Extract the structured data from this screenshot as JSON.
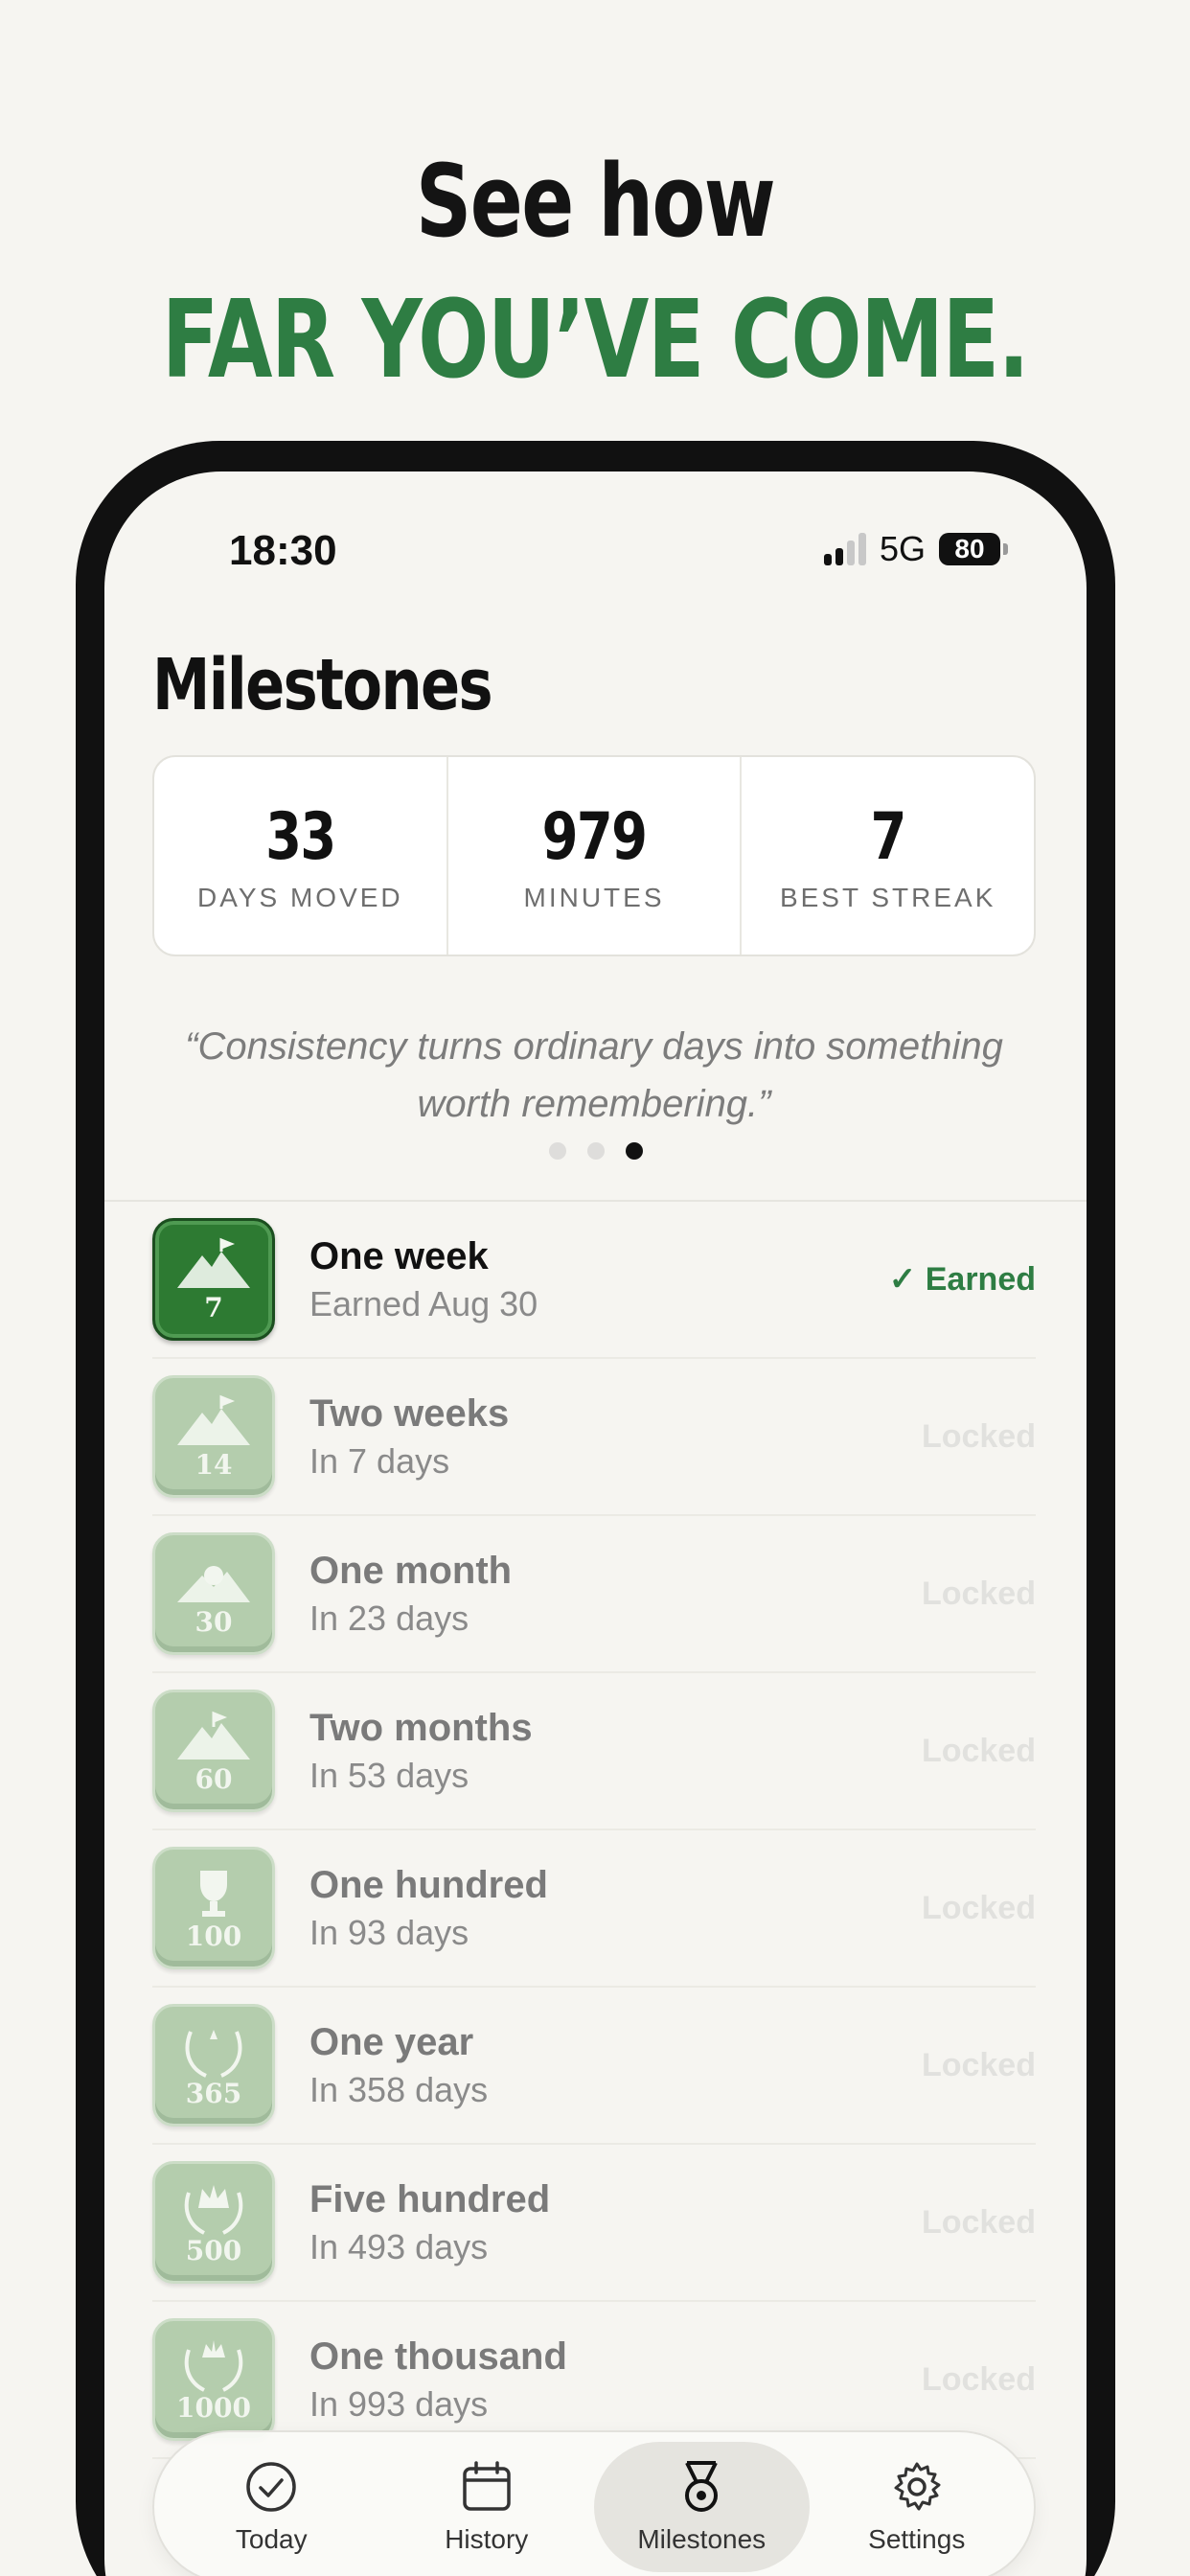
{
  "headline": {
    "line1": "See how",
    "line2": "FAR YOU’VE COME."
  },
  "status_bar": {
    "time": "18:30",
    "network": "5G",
    "battery": "80"
  },
  "page_title": "Milestones",
  "stats": [
    {
      "value": "33",
      "label": "DAYS MOVED"
    },
    {
      "value": "979",
      "label": "MINUTES"
    },
    {
      "value": "7",
      "label": "BEST STREAK"
    }
  ],
  "quote": "“Consistency turns ordinary days into something worth remembering.”",
  "quote_pager": {
    "count": 3,
    "active_index": 2
  },
  "milestones": [
    {
      "badge": "7",
      "name": "One week",
      "sub": "Earned Aug 30",
      "state": "✓ Earned",
      "earned": true
    },
    {
      "badge": "14",
      "name": "Two weeks",
      "sub": "In 7 days",
      "state": "Locked",
      "earned": false
    },
    {
      "badge": "30",
      "name": "One month",
      "sub": "In 23 days",
      "state": "Locked",
      "earned": false
    },
    {
      "badge": "60",
      "name": "Two months",
      "sub": "In 53 days",
      "state": "Locked",
      "earned": false
    },
    {
      "badge": "100",
      "name": "One hundred",
      "sub": "In 93 days",
      "state": "Locked",
      "earned": false
    },
    {
      "badge": "365",
      "name": "One year",
      "sub": "In 358 days",
      "state": "Locked",
      "earned": false
    },
    {
      "badge": "500",
      "name": "Five hundred",
      "sub": "In 493 days",
      "state": "Locked",
      "earned": false
    },
    {
      "badge": "1000",
      "name": "One thousand",
      "sub": "In 993 days",
      "state": "Locked",
      "earned": false
    }
  ],
  "tabs": [
    {
      "label": "Today",
      "icon": "check-circle-icon",
      "active": false
    },
    {
      "label": "History",
      "icon": "calendar-icon",
      "active": false
    },
    {
      "label": "Milestones",
      "icon": "medal-icon",
      "active": true
    },
    {
      "label": "Settings",
      "icon": "gear-icon",
      "active": false
    }
  ],
  "colors": {
    "accent": "#2e7d43",
    "background": "#f6f5f1",
    "locked_badge": "#a9c7a2"
  }
}
